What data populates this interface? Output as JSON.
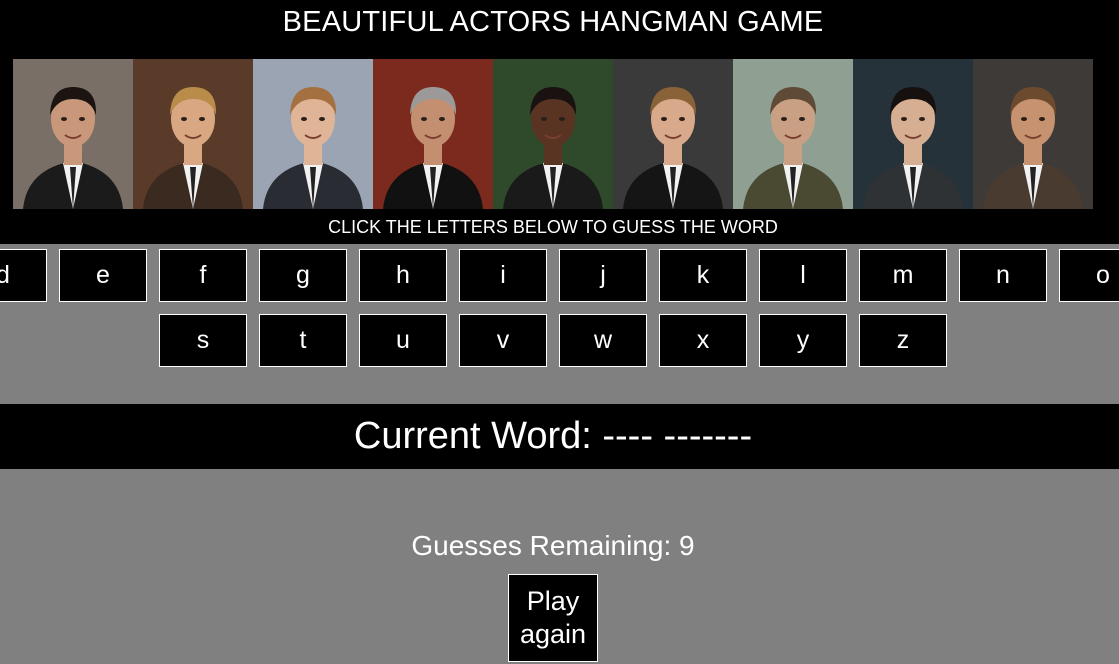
{
  "header": {
    "title": "BEAUTIFUL ACTORS HANGMAN GAME",
    "instructions": "CLICK THE LETTERS BELOW TO GUESS THE WORD"
  },
  "photos": [
    {
      "icon": "actor-photo-1",
      "bg": "#7a6f66",
      "suit": "#1b1b1b",
      "skin": "#c9987b",
      "hair": "#1c1410"
    },
    {
      "icon": "actor-photo-2",
      "bg": "#5a3a28",
      "suit": "#3b2a20",
      "skin": "#d9a883",
      "hair": "#b98c4a"
    },
    {
      "icon": "actor-photo-3",
      "bg": "#9aa4b3",
      "suit": "#2a2c33",
      "skin": "#e0b497",
      "hair": "#a5703f"
    },
    {
      "icon": "actor-photo-4",
      "bg": "#7c2a1e",
      "suit": "#111111",
      "skin": "#c48f71",
      "hair": "#9c9a98"
    },
    {
      "icon": "actor-photo-5",
      "bg": "#2f4a2a",
      "suit": "#1a1a1a",
      "skin": "#5a3423",
      "hair": "#1a1210"
    },
    {
      "icon": "actor-photo-6",
      "bg": "#3a3a3a",
      "suit": "#151515",
      "skin": "#d8a98a",
      "hair": "#8a6238"
    },
    {
      "icon": "actor-photo-7",
      "bg": "#8fa093",
      "suit": "#4a4a32",
      "skin": "#c9a083",
      "hair": "#5e4a36"
    },
    {
      "icon": "actor-photo-8",
      "bg": "#263239",
      "suit": "#2e3234",
      "skin": "#d6ae92",
      "hair": "#16110f"
    },
    {
      "icon": "actor-photo-9",
      "bg": "#3e3a38",
      "suit": "#4a3b31",
      "skin": "#c7926f",
      "hair": "#6b4a2d"
    }
  ],
  "keyboard": {
    "row1": [
      "d",
      "e",
      "f",
      "g",
      "h",
      "i",
      "j",
      "k",
      "l",
      "m",
      "n",
      "o"
    ],
    "row2": [
      "s",
      "t",
      "u",
      "v",
      "w",
      "x",
      "y",
      "z"
    ]
  },
  "game": {
    "current_word_label": "Current Word: ---- -------",
    "guesses_label": "Guesses Remaining: 9",
    "play_again_line1": "Play",
    "play_again_line2": "again"
  }
}
